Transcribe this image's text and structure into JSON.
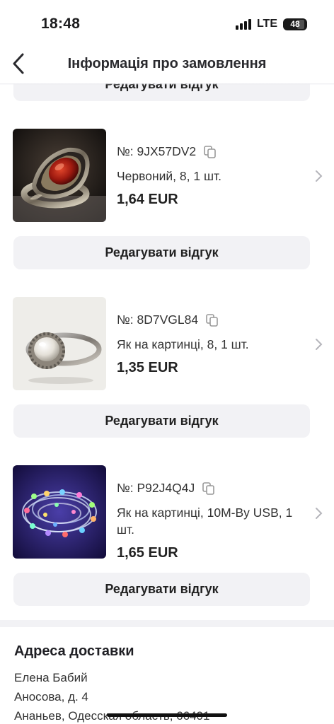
{
  "status_bar": {
    "time": "18:48",
    "network": "LTE",
    "battery": "48"
  },
  "nav": {
    "title": "Інформація про замовлення"
  },
  "top_edit_label": "Редагувати відгук",
  "products": [
    {
      "order_no": "№: 9JX57DV2",
      "variant": "Червоний, 8, 1 шт.",
      "price": "1,64 EUR",
      "edit_label": "Редагувати відгук"
    },
    {
      "order_no": "№: 8D7VGL84",
      "variant": "Як на картинці, 8, 1 шт.",
      "price": "1,35 EUR",
      "edit_label": "Редагувати відгук"
    },
    {
      "order_no": "№: P92J4Q4J",
      "variant": "Як на картинці, 10M-By USB, 1 шт.",
      "price": "1,65 EUR",
      "edit_label": "Редагувати відгук"
    }
  ],
  "address": {
    "title": "Адреса доставки",
    "name": "Елена Бабий",
    "street": "Аносова, д. 4",
    "city": "Ананьев, Одесская область, 66401"
  },
  "colors": {
    "button_bg": "#f2f2f5",
    "divider": "#f2f2f5",
    "text": "#1c1c1e"
  }
}
